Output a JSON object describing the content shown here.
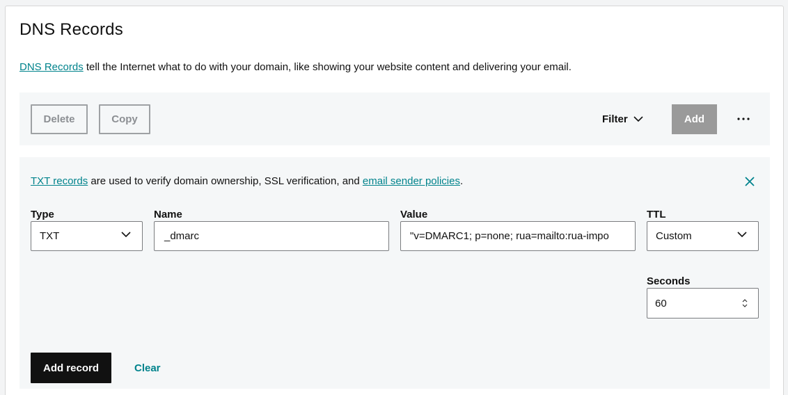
{
  "page": {
    "title": "DNS Records",
    "intro_link": "DNS Records",
    "intro_text": " tell the Internet what to do with your domain, like showing your website content and delivering your email."
  },
  "toolbar": {
    "delete_label": "Delete",
    "copy_label": "Copy",
    "filter_label": "Filter",
    "add_label": "Add",
    "more_icon": "ellipsis-icon"
  },
  "form": {
    "banner": {
      "link1": "TXT records",
      "text1": " are used to verify domain ownership, SSL verification, and ",
      "link2": "email sender policies",
      "text2": "."
    },
    "type": {
      "label": "Type",
      "value": "TXT"
    },
    "name": {
      "label": "Name",
      "value": "_dmarc"
    },
    "value": {
      "label": "Value",
      "value": "\"v=DMARC1; p=none; rua=mailto:rua-impo"
    },
    "ttl": {
      "label": "TTL",
      "value": "Custom"
    },
    "seconds": {
      "label": "Seconds",
      "value": "60"
    },
    "add_record_label": "Add record",
    "clear_label": "Clear"
  },
  "colors": {
    "accent": "#00838c",
    "primary_button": "#111111",
    "disabled_button": "#9a9a9a",
    "panel_bg": "#f5f7f8"
  }
}
